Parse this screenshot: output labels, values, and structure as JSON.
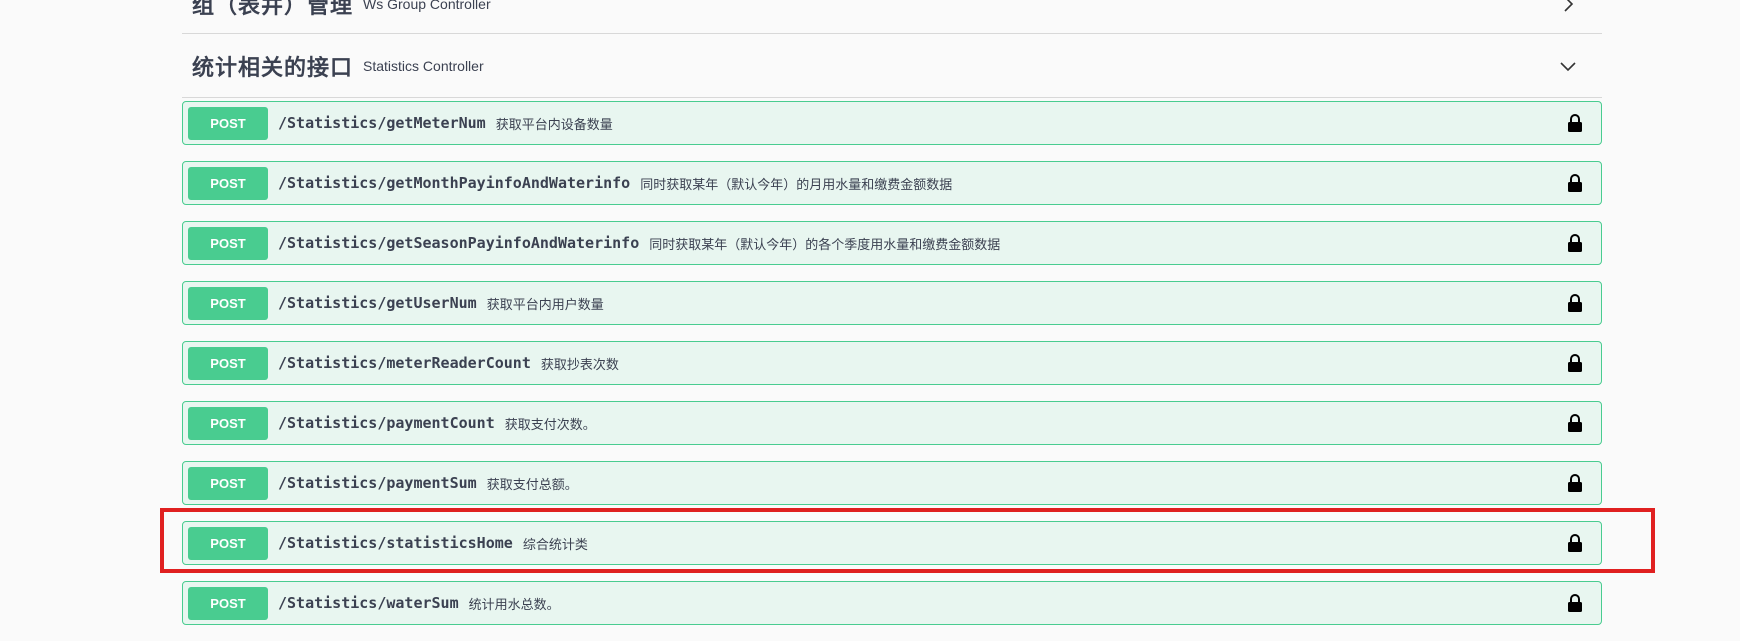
{
  "sections": {
    "first": {
      "title": "组（表井）管理",
      "desc": "Ws Group Controller"
    },
    "second": {
      "title": "统计相关的接口",
      "desc": "Statistics Controller"
    }
  },
  "operations": [
    {
      "method": "POST",
      "path": "/Statistics/getMeterNum",
      "summary": "获取平台内设备数量"
    },
    {
      "method": "POST",
      "path": "/Statistics/getMonthPayinfoAndWaterinfo",
      "summary": "同时获取某年（默认今年）的月用水量和缴费金额数据"
    },
    {
      "method": "POST",
      "path": "/Statistics/getSeasonPayinfoAndWaterinfo",
      "summary": "同时获取某年（默认今年）的各个季度用水量和缴费金额数据"
    },
    {
      "method": "POST",
      "path": "/Statistics/getUserNum",
      "summary": "获取平台内用户数量"
    },
    {
      "method": "POST",
      "path": "/Statistics/meterReaderCount",
      "summary": "获取抄表次数"
    },
    {
      "method": "POST",
      "path": "/Statistics/paymentCount",
      "summary": "获取支付次数。"
    },
    {
      "method": "POST",
      "path": "/Statistics/paymentSum",
      "summary": "获取支付总额。"
    },
    {
      "method": "POST",
      "path": "/Statistics/statisticsHome",
      "summary": "综合统计类"
    },
    {
      "method": "POST",
      "path": "/Statistics/waterSum",
      "summary": "统计用水总数。"
    }
  ],
  "colors": {
    "post": "#49cc90",
    "post_bg": "#e8f6f0",
    "highlight": "#e02020"
  }
}
